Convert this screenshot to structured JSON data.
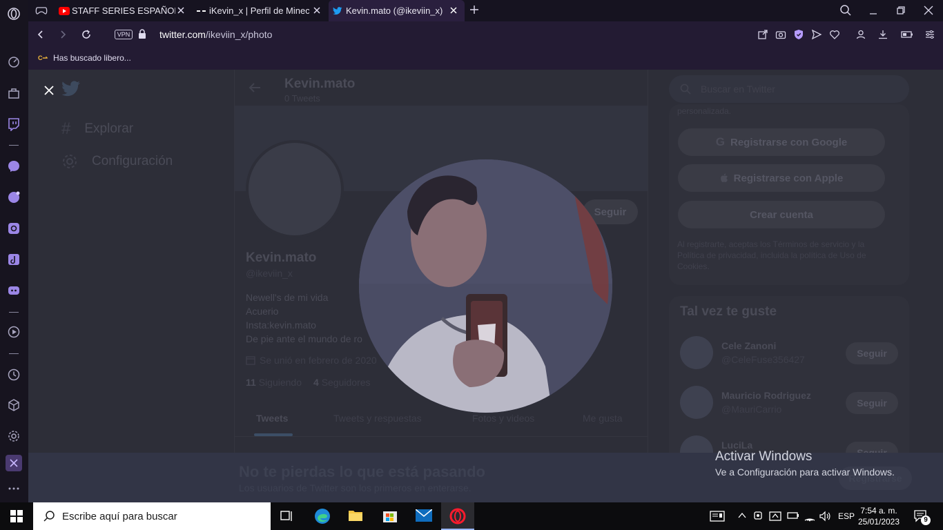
{
  "browser": {
    "tabs": [
      {
        "title": "STAFF SERIES ESPAÑOL | EL",
        "icon": "youtube-icon"
      },
      {
        "title": "iKevin_x | Perfil de Minecraf",
        "icon": "namemc-icon"
      },
      {
        "title": "Kevin.mato (@ikeviin_x) / Tw",
        "icon": "twitter-icon",
        "active": true
      }
    ],
    "vpn_label": "VPN",
    "url_host": "twitter.com",
    "url_path": "/ikeviin_x/photo",
    "bookmark_label": "Has buscado libero..."
  },
  "twitter": {
    "nav": {
      "explore": "Explorar",
      "settings": "Configuración"
    },
    "profile": {
      "name": "Kevin.mato",
      "tweet_count": "0 Tweets",
      "handle": "@ikeviin_x",
      "bio": [
        "Newell's de mi vida",
        "Acuerio",
        "Insta:kevin.mato",
        "De pie ante el mundo de ro"
      ],
      "joined": "Se unió en febrero de 2020",
      "following_count": "11",
      "following_label": "Siguiendo",
      "followers_count": "4",
      "followers_label": "Seguidores",
      "follow_button": "Seguir"
    },
    "tabs": [
      "Tweets",
      "Tweets y respuestas",
      "Fotos y videos",
      "Me gusta"
    ],
    "search_placeholder": "Buscar en Twitter",
    "signup": {
      "personalized": "personalizada.",
      "google": "Registrarse con Google",
      "apple": "Registrarse con Apple",
      "create": "Crear cuenta",
      "legal": "Al registrarte, aceptas los Términos de servicio y la Política de privacidad, incluida la política de Uso de Cookies."
    },
    "suggestions": {
      "title": "Tal vez te guste",
      "follow_label": "Seguir",
      "users": [
        {
          "name": "Cele Zanoni",
          "handle": "@CeleFuse356427"
        },
        {
          "name": "Mauricio Rodriguez",
          "handle": "@MauriCarrio"
        },
        {
          "name": "LuciLa",
          "handle": ""
        }
      ]
    },
    "banner": {
      "title": "No te pierdas lo que está pasando",
      "subtitle": "Los usuarios de Twitter son los primeros en enterarse.",
      "register_button": "Registrarse"
    }
  },
  "activation": {
    "title": "Activar Windows",
    "subtitle": "Ve a Configuración para activar Windows."
  },
  "taskbar": {
    "search_placeholder": "Escribe aquí para buscar",
    "language": "ESP",
    "time": "7:54 a. m.",
    "date": "25/01/2023",
    "notification_count": "9"
  },
  "colors": {
    "opera_red": "#ff1b2d",
    "twitter_blue": "#1d9bf0",
    "sidebar_accent": "#9b86e6"
  }
}
